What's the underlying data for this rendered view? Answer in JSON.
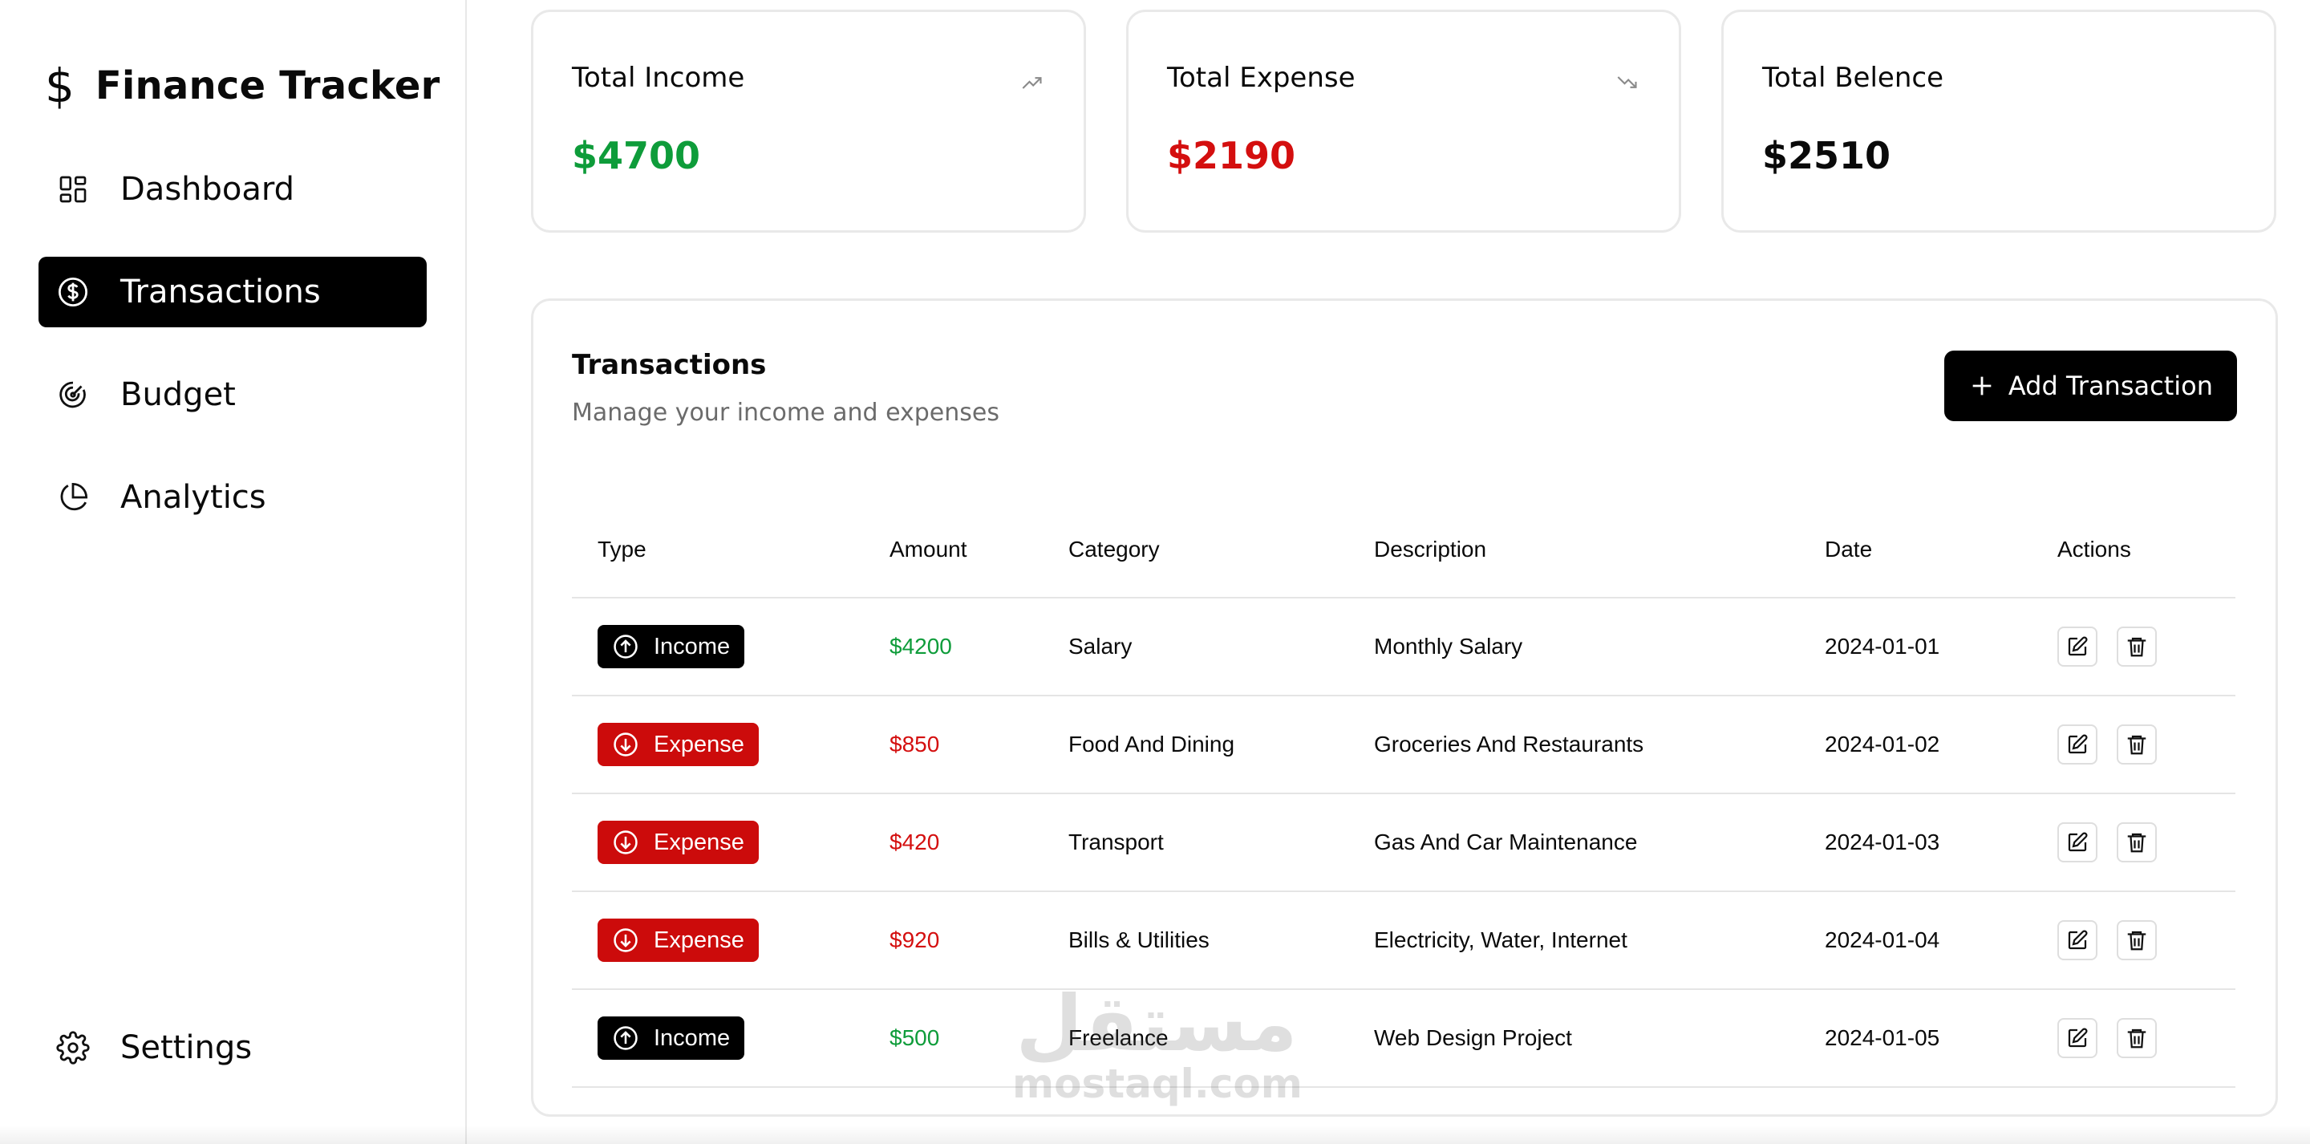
{
  "app": {
    "brand_icon": "$",
    "title": "Finance Tracker"
  },
  "nav": [
    {
      "label": "Dashboard",
      "icon": "dashboard-grid-icon",
      "active": false
    },
    {
      "label": "Transactions",
      "icon": "dollar-circle-icon",
      "active": true
    },
    {
      "label": "Budget",
      "icon": "target-icon",
      "active": false
    },
    {
      "label": "Analytics",
      "icon": "pie-chart-icon",
      "active": false
    }
  ],
  "settings": {
    "label": "Settings",
    "icon": "gear-icon"
  },
  "summary": {
    "income": {
      "label": "Total Income",
      "value": "$4700",
      "trend_icon": "trending-up-icon"
    },
    "expense": {
      "label": "Total Expense",
      "value": "$2190",
      "trend_icon": "trending-down-icon"
    },
    "balance": {
      "label": "Total Belence",
      "value": "$2510"
    }
  },
  "transactions": {
    "title": "Transactions",
    "subtitle": "Manage your income and expenses",
    "add_button": "Add Transaction",
    "columns": [
      "Type",
      "Amount",
      "Category",
      "Description",
      "Date",
      "Actions"
    ],
    "rows": [
      {
        "type": "Income",
        "amount": "$4200",
        "category": "Salary",
        "description": "Monthly Salary",
        "date": "2024-01-01"
      },
      {
        "type": "Expense",
        "amount": "$850",
        "category": "Food And Dining",
        "description": "Groceries And Restaurants",
        "date": "2024-01-02"
      },
      {
        "type": "Expense",
        "amount": "$420",
        "category": "Transport",
        "description": "Gas And Car Maintenance",
        "date": "2024-01-03"
      },
      {
        "type": "Expense",
        "amount": "$920",
        "category": "Bills & Utilities",
        "description": "Electricity, Water, Internet",
        "date": "2024-01-04"
      },
      {
        "type": "Income",
        "amount": "$500",
        "category": "Freelance",
        "description": "Web Design Project",
        "date": "2024-01-05"
      }
    ]
  },
  "watermark": {
    "arabic": "مستقل",
    "latin": "mostaql.com"
  },
  "colors": {
    "income": "#0e9c3a",
    "expense": "#d40f0f",
    "expense_badge": "#cc0b0b",
    "primary": "#000000"
  }
}
